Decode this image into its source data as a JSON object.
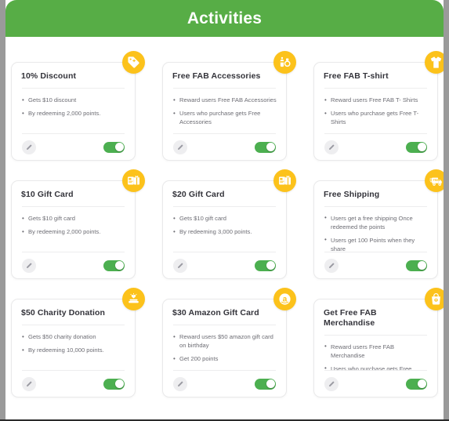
{
  "header": {
    "title": "Activities",
    "bg_color": "#57ad46"
  },
  "theme": {
    "badge_color": "#fcc21b",
    "toggle_on_color": "#4caf50",
    "card_bg": "#ffffff",
    "title_color": "#33333a",
    "body_text_color": "#6d6d74"
  },
  "controls": {
    "edit_icon": "pencil-icon",
    "toggle_state": "on"
  },
  "cards": [
    {
      "title": "10% Discount",
      "icon": "price-tag-icon",
      "bullets": [
        "Gets $10 discount",
        "By redeeming 2,000 points."
      ],
      "toggle": "on"
    },
    {
      "title": "Free FAB Accessories",
      "icon": "accessories-icon",
      "bullets": [
        "Reward users Free FAB Accessories",
        "Users who purchase gets Free Accessories"
      ],
      "toggle": "on"
    },
    {
      "title": "Free FAB T-shirt",
      "icon": "tshirt-icon",
      "bullets": [
        "Reward users Free FAB T- Shirts",
        "Users who purchase gets Free T-Shirts"
      ],
      "toggle": "on"
    },
    {
      "title": "$10 Gift Card",
      "icon": "gift-card-icon",
      "bullets": [
        "Gets $10 gift card",
        "By redeeming 2,000 points."
      ],
      "toggle": "on"
    },
    {
      "title": "$20 Gift Card",
      "icon": "gift-card-icon",
      "bullets": [
        "Gets $10 gift card",
        "By redeeming 3,000 points."
      ],
      "toggle": "on"
    },
    {
      "title": "Free Shipping",
      "icon": "delivery-truck-icon",
      "bullets": [
        "Users get a free shipping Once redeemed the points",
        "Users get 100 Points when they share"
      ],
      "toggle": "on"
    },
    {
      "title": "$50 Charity Donation",
      "icon": "charity-donation-icon",
      "bullets": [
        "Gets $50 charity donation",
        "By redeeming 10,000 points."
      ],
      "toggle": "on"
    },
    {
      "title": "$30 Amazon Gift Card",
      "icon": "amazon-icon",
      "bullets": [
        "Reward users $50 amazon gift card on birthday",
        "Get 200 points"
      ],
      "toggle": "on"
    },
    {
      "title": "Get Free FAB Merchandise",
      "icon": "merchandise-bag-icon",
      "bullets": [
        "Reward users Free FAB Merchandise",
        "Users who purchase gets Free merchandise"
      ],
      "toggle": "on"
    }
  ]
}
